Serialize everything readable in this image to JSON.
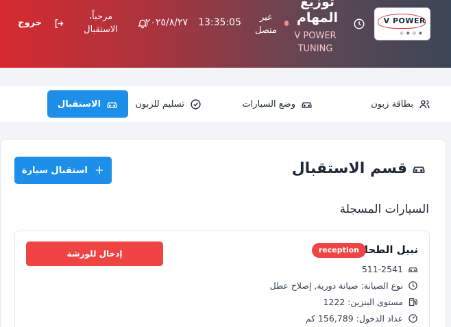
{
  "header": {
    "logo_text": "V POWER",
    "brand_title": "توزيع المهام",
    "brand_subtitle": "V POWER TUNING",
    "connection_status": "غير متصل",
    "time": "13:35:05",
    "date": "٢٠٢٥/٨/٢٧",
    "welcome": "مرحباً، الاستقبال",
    "logout_label": "خروج",
    "colors": {
      "gradient_start": "#d62a30",
      "gradient_end": "#3b4656",
      "status_dot": "#f08a8f"
    }
  },
  "tabs": [
    {
      "label": "بطاقة زبون",
      "icon": "users-icon",
      "active": false
    },
    {
      "label": "وضع السيارات",
      "icon": "car-icon",
      "active": false
    },
    {
      "label": "تسليم للزبون",
      "icon": "check-circle-icon",
      "active": false
    },
    {
      "label": "الاستقبال",
      "icon": "car-icon",
      "active": true
    }
  ],
  "main": {
    "section_title": "قسم الاستقبال",
    "add_button_label": "استقبال سيارة",
    "list_title": "السيارات المسجلة"
  },
  "car": {
    "customer_name": "نبيل الطحله",
    "status_badge": "reception",
    "plate": "511-2541",
    "maintenance": "نوع الصيانة: صيانة دورية, إصلاح عطل",
    "fuel": "مستوى البنزين: 1222",
    "odometer": "عداد الدخول: 156,789 كم",
    "action_label": "إدخال للورشة"
  },
  "colors": {
    "accent": "#1e8fe8",
    "danger": "#ef4444",
    "background": "#f3f4f6"
  }
}
